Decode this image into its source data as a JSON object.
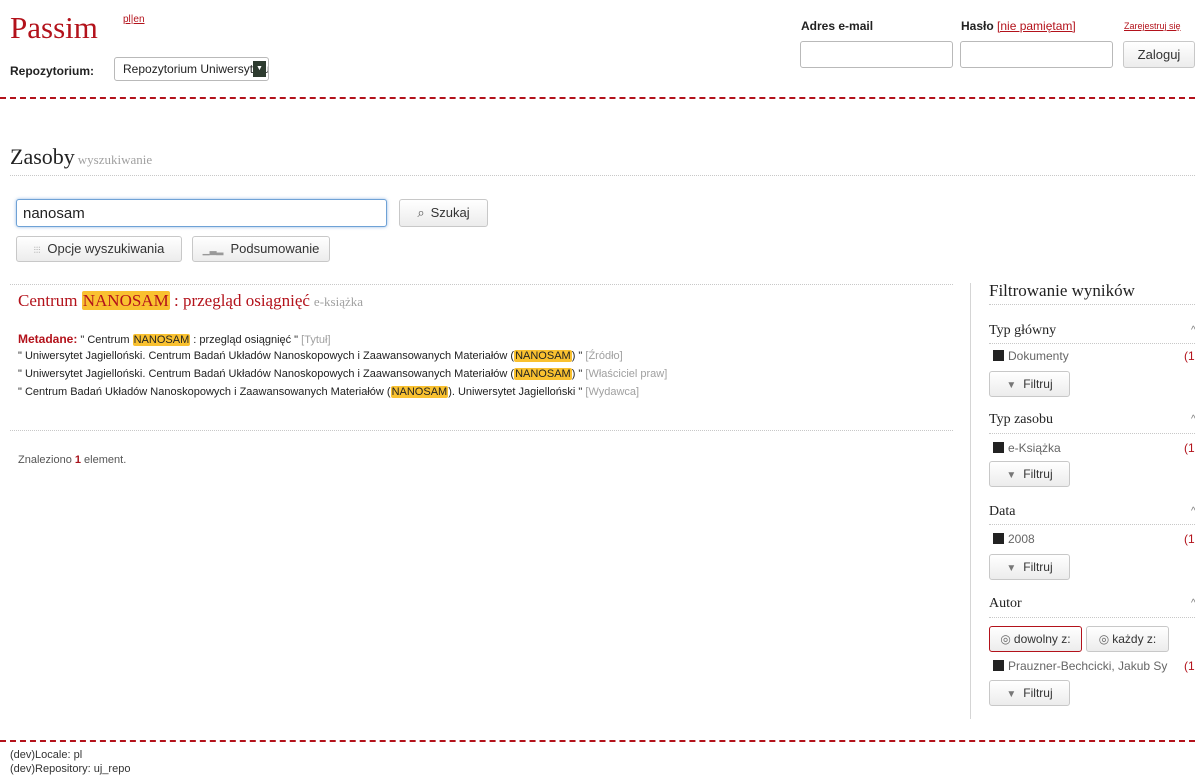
{
  "header": {
    "logo": "Passim",
    "lang": "pl|en",
    "repository_label": "Repozytorium:",
    "repository_value": "Repozytorium Uniwersytetu",
    "email_label": "Adres e-mail",
    "password_label": "Hasło",
    "forgot_label": "[nie pamiętam]",
    "register_label": "Zarejestruj się",
    "login_button": "Zaloguj"
  },
  "page": {
    "title": "Zasoby",
    "subtitle": "wyszukiwanie"
  },
  "search": {
    "query": "nanosam",
    "search_button": "Szukaj",
    "options_button": "Opcje wyszukiwania",
    "summary_button": "Podsumowanie"
  },
  "results": [
    {
      "title_before": "Centrum ",
      "title_hl": "NANOSAM",
      "title_after": " : przegląd osiągnięć",
      "type": "e-książka",
      "metadata_label": "Metadane:",
      "lines": [
        {
          "before": " \" Centrum ",
          "hl": "NANOSAM",
          "after": " : przegląd osiągnięć \" ",
          "field": "[Tytuł]"
        },
        {
          "before": "\" Uniwersytet Jagielloński. Centrum Badań Układów Nanoskopowych i Zaawansowanych Materiałów (",
          "hl": "NANOSAM",
          "after": ") \" ",
          "field": "[Źródło]"
        },
        {
          "before": "\" Uniwersytet Jagielloński. Centrum Badań Układów Nanoskopowych i Zaawansowanych Materiałów (",
          "hl": "NANOSAM",
          "after": ") \" ",
          "field": "[Właściciel praw]"
        },
        {
          "before": "\" Centrum Badań Układów Nanoskopowych i Zaawansowanych Materiałów (",
          "hl": "NANOSAM",
          "after": "). Uniwersytet Jagielloński \" ",
          "field": "[Wydawca]"
        }
      ]
    }
  ],
  "summary": {
    "prefix": "Znaleziono ",
    "count": "1",
    "suffix": " element."
  },
  "filters": {
    "heading": "Filtrowanie wyników",
    "filter_button": "Filtruj",
    "groups": [
      {
        "title": "Typ główny",
        "item": "Dokumenty",
        "count": "(1"
      },
      {
        "title": "Typ zasobu",
        "item": "e-Książka",
        "count": "(1"
      },
      {
        "title": "Data",
        "item": "2008",
        "count": "(1"
      },
      {
        "title": "Autor",
        "item": "Prauzner-Bechcicki, Jakub Sy",
        "count": "(1",
        "mode_any": "dowolny z:",
        "mode_all": "każdy z:"
      }
    ]
  },
  "footer": {
    "locale_line": "(dev)Locale: pl",
    "repo_line": "(dev)Repository: uj_repo"
  },
  "colors": {
    "brand_red": "#b3121b",
    "highlight": "#f9c130"
  }
}
